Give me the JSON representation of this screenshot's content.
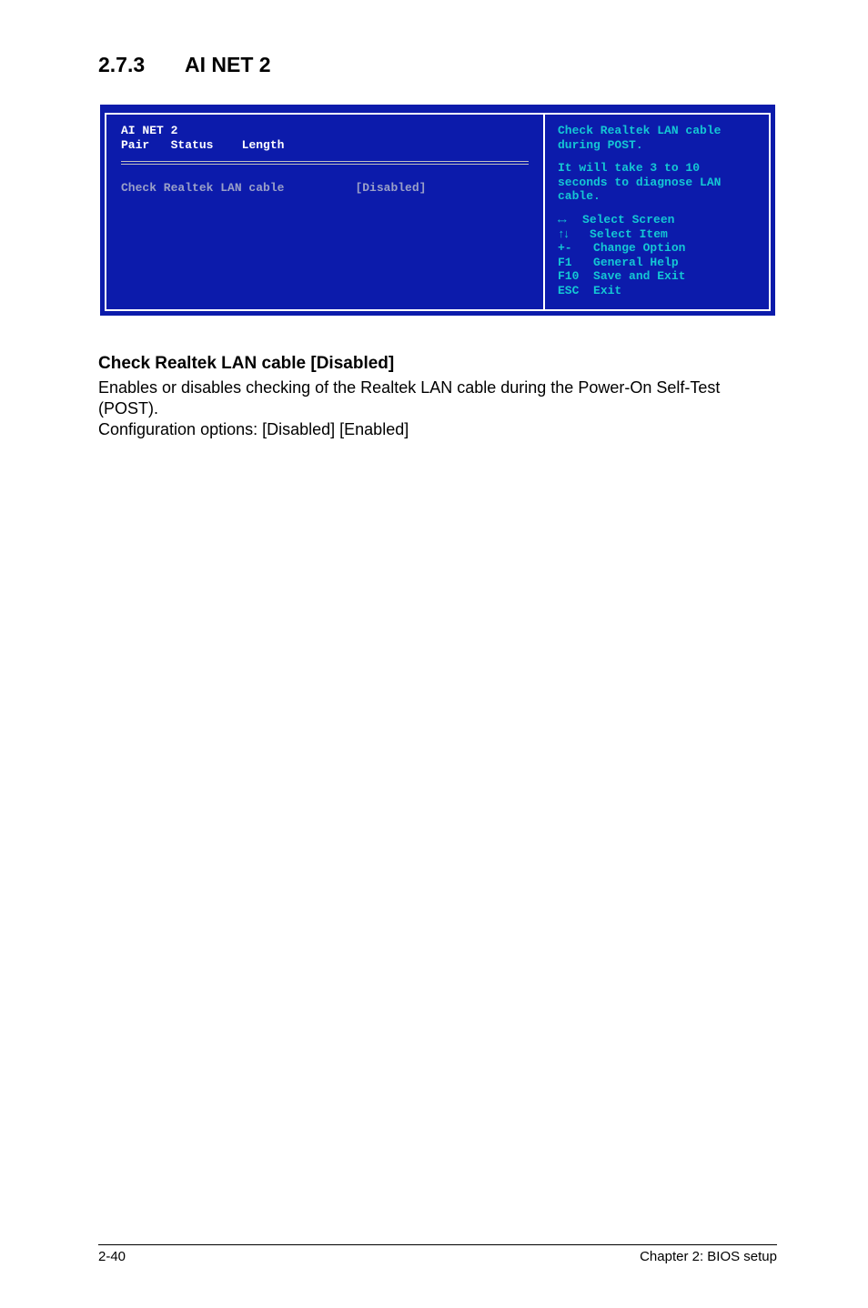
{
  "section": {
    "number": "2.7.3",
    "title": "AI NET 2"
  },
  "bios": {
    "header_title": "AI NET 2",
    "col_pair": "Pair",
    "col_status": "Status",
    "col_length": "Length",
    "option_label": "Check Realtek LAN cable",
    "option_value": "[Disabled]",
    "help_line1": "Check Realtek LAN cable during POST.",
    "help_line2": "It will take 3 to 10 seconds to diagnose LAN cable.",
    "keys": {
      "k1_label": "Select Screen",
      "k2_label": "Select Item",
      "k3_key": "+-",
      "k3_label": "Change Option",
      "k4_key": "F1",
      "k4_label": "General Help",
      "k5_key": "F10",
      "k5_label": "Save and Exit",
      "k6_key": "ESC",
      "k6_label": "Exit"
    }
  },
  "doc": {
    "heading": "Check Realtek LAN cable [Disabled]",
    "para1": "Enables or disables checking of the Realtek LAN cable during the Power-On Self-Test (POST).",
    "para2": "Configuration options: [Disabled] [Enabled]"
  },
  "footer": {
    "left": "2-40",
    "right": "Chapter 2: BIOS setup"
  }
}
